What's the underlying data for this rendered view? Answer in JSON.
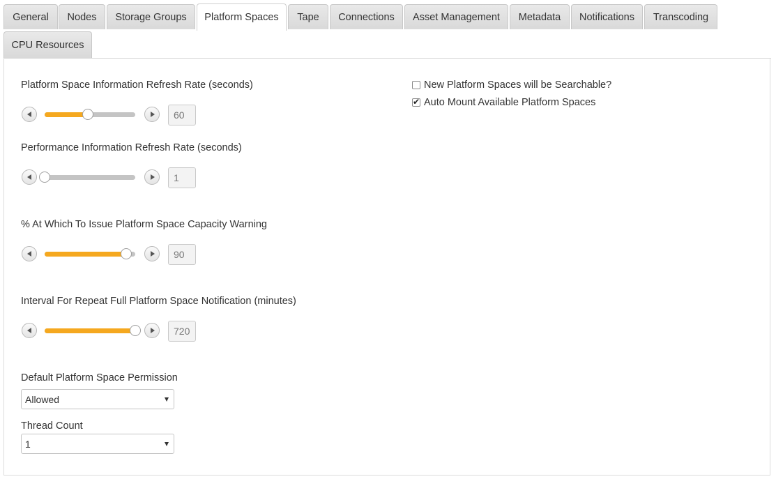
{
  "tabs": [
    {
      "label": "General"
    },
    {
      "label": "Nodes"
    },
    {
      "label": "Storage Groups"
    },
    {
      "label": "Platform Spaces",
      "active": true
    },
    {
      "label": "Tape"
    },
    {
      "label": "Connections"
    },
    {
      "label": "Asset Management"
    },
    {
      "label": "Metadata"
    },
    {
      "label": "Notifications"
    },
    {
      "label": "Transcoding"
    },
    {
      "label": "CPU Resources"
    }
  ],
  "sliders": [
    {
      "label": "Platform Space Information Refresh Rate (seconds)",
      "value": "60",
      "fill_fraction": 0.48,
      "icons": [
        "arrow-left-icon",
        "arrow-right-icon"
      ]
    },
    {
      "label": "Performance Information Refresh Rate (seconds)",
      "value": "1",
      "fill_fraction": 0.0,
      "icons": [
        "arrow-left-icon",
        "arrow-right-icon"
      ]
    },
    {
      "label": "% At Which To Issue Platform Space Capacity Warning",
      "value": "90",
      "fill_fraction": 0.9,
      "icons": [
        "arrow-left-icon",
        "arrow-right-icon"
      ]
    },
    {
      "label": "Interval For Repeat Full Platform Space Notification (minutes)",
      "value": "720",
      "fill_fraction": 1.0,
      "icons": [
        "arrow-left-icon",
        "arrow-right-icon"
      ]
    }
  ],
  "selects": [
    {
      "label": "Default Platform Space Permission",
      "value": "Allowed"
    },
    {
      "label": "Thread Count",
      "value": "1"
    }
  ],
  "checkboxes": [
    {
      "label": "New Platform Spaces will be Searchable?",
      "checked": false
    },
    {
      "label": "Auto Mount Available Platform Spaces",
      "checked": true
    }
  ],
  "colors": {
    "accent": "#f5a81f",
    "track": "#c4c4c4"
  }
}
